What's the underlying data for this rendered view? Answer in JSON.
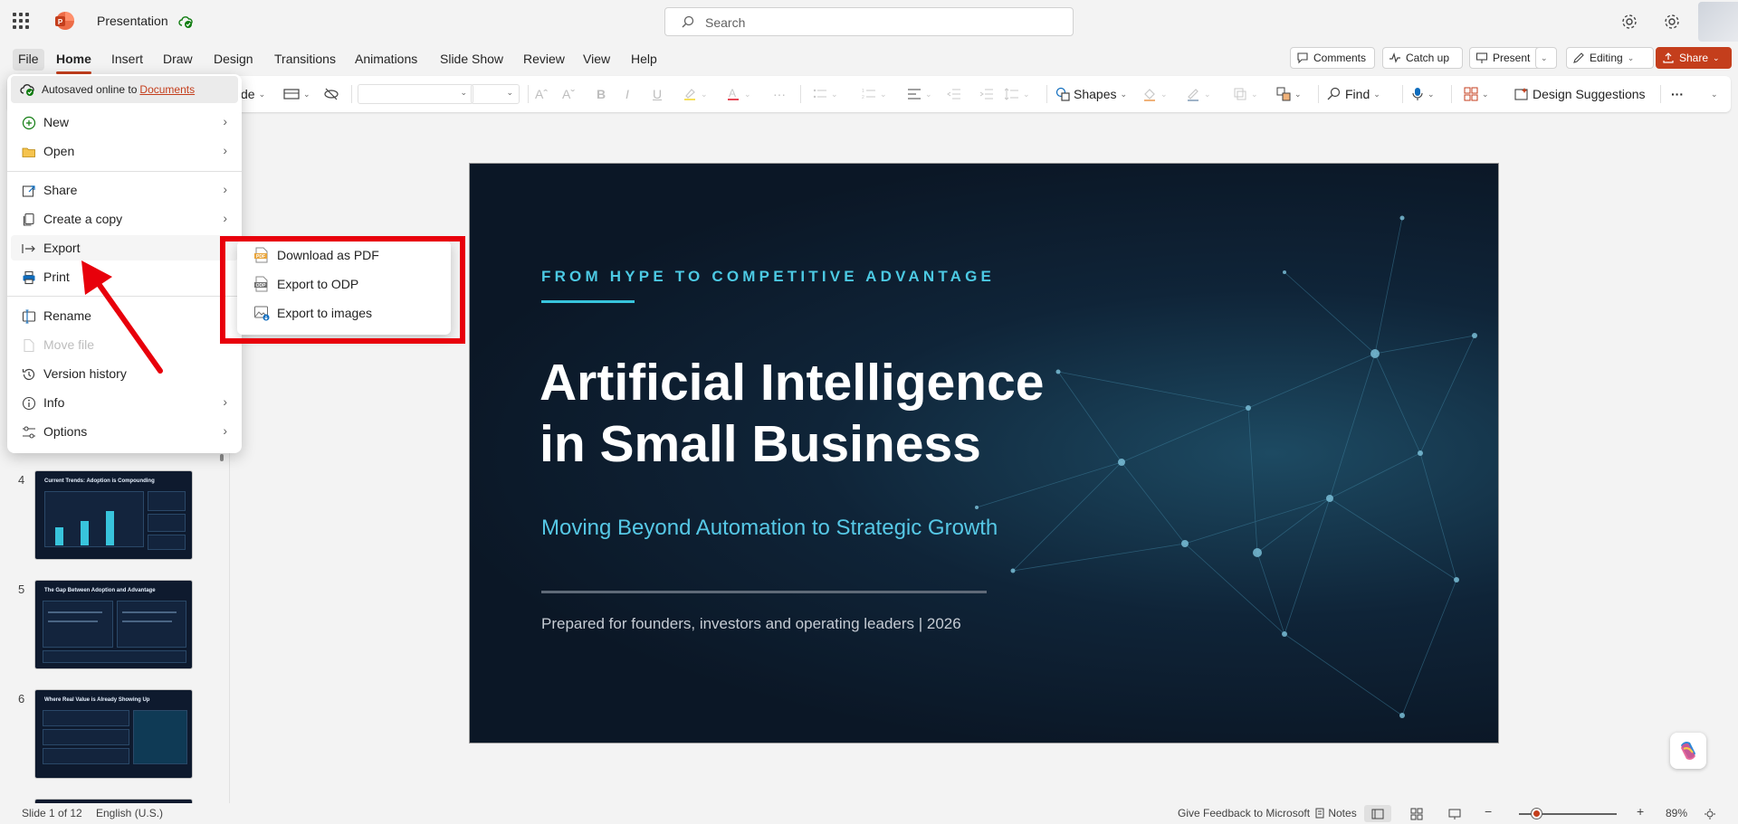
{
  "app": {
    "title": "Presentation",
    "search_placeholder": "Search"
  },
  "tabs": [
    "File",
    "Home",
    "Insert",
    "Draw",
    "Design",
    "Transitions",
    "Animations",
    "Slide Show",
    "Review",
    "View",
    "Help"
  ],
  "actions": {
    "comments": "Comments",
    "catch_up": "Catch up",
    "present": "Present",
    "editing": "Editing",
    "share": "Share"
  },
  "ribbon": {
    "layout_fragment": "de",
    "shapes": "Shapes",
    "find": "Find",
    "design_suggestions": "Design Suggestions"
  },
  "file_menu": {
    "autosave_text": "Autosaved online to",
    "autosave_link": "Documents",
    "items": [
      {
        "label": "New",
        "submenu": true
      },
      {
        "label": "Open",
        "submenu": true
      },
      {
        "label": "Share",
        "submenu": true
      },
      {
        "label": "Create a copy",
        "submenu": true
      },
      {
        "label": "Export",
        "submenu": false
      },
      {
        "label": "Print",
        "submenu": false
      },
      {
        "label": "Rename",
        "submenu": false
      },
      {
        "label": "Move file",
        "submenu": false,
        "disabled": true
      },
      {
        "label": "Version history",
        "submenu": false
      },
      {
        "label": "Info",
        "submenu": true
      },
      {
        "label": "Options",
        "submenu": true
      }
    ]
  },
  "export_submenu": {
    "items": [
      "Download as PDF",
      "Export to ODP",
      "Export to images"
    ]
  },
  "thumbnails": [
    {
      "number": "4",
      "title": "Current Trends: Adoption is Compounding"
    },
    {
      "number": "5",
      "title": "The Gap Between Adoption and Advantage"
    },
    {
      "number": "6",
      "title": "Where Real Value is Already Showing Up"
    }
  ],
  "slide": {
    "kicker": "FROM HYPE TO COMPETITIVE ADVANTAGE",
    "title_line1": "Artificial Intelligence",
    "title_line2": "in Small Business",
    "subtitle": "Moving Beyond Automation to Strategic Growth",
    "footer": "Prepared for founders, investors and operating leaders | 2026"
  },
  "status": {
    "slide_info": "Slide 1 of 12",
    "language": "English (U.S.)",
    "feedback": "Give Feedback to Microsoft",
    "notes": "Notes",
    "zoom": "89%"
  },
  "colors": {
    "accent": "#c43e1c",
    "slide_bg": "#0b1726",
    "slide_accent": "#4cc9e3",
    "annotation": "#e8000b"
  }
}
